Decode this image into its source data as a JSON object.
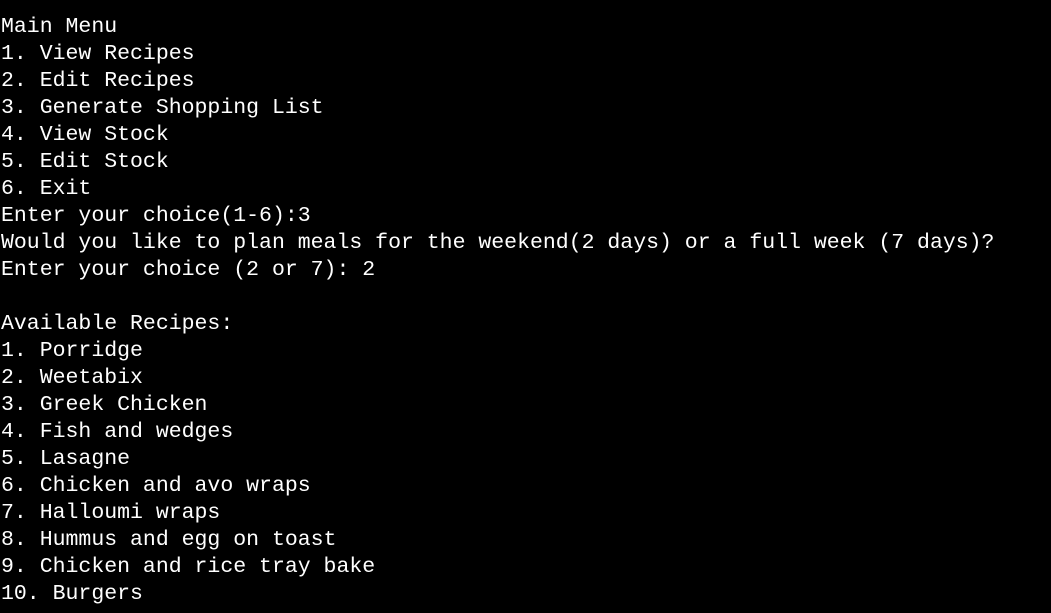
{
  "colors": {
    "background": "#000000",
    "text": "#ffffff"
  },
  "menu": {
    "title": "Main Menu",
    "items": [
      "1. View Recipes",
      "2. Edit Recipes",
      "3. Generate Shopping List",
      "4. View Stock",
      "5. Edit Stock",
      "6. Exit"
    ],
    "prompt": "Enter your choice(1-6):3"
  },
  "plan": {
    "question": "Would you like to plan meals for the weekend(2 days) or a full week (7 days)?",
    "prompt": "Enter your choice (2 or 7): 2"
  },
  "recipes": {
    "header": "Available Recipes:",
    "items": [
      "1. Porridge",
      "2. Weetabix",
      "3. Greek Chicken",
      "4. Fish and wedges",
      "5. Lasagne",
      "6. Chicken and avo wraps",
      "7. Halloumi wraps",
      "8. Hummus and egg on toast",
      "9. Chicken and rice tray bake",
      "10. Burgers"
    ]
  }
}
